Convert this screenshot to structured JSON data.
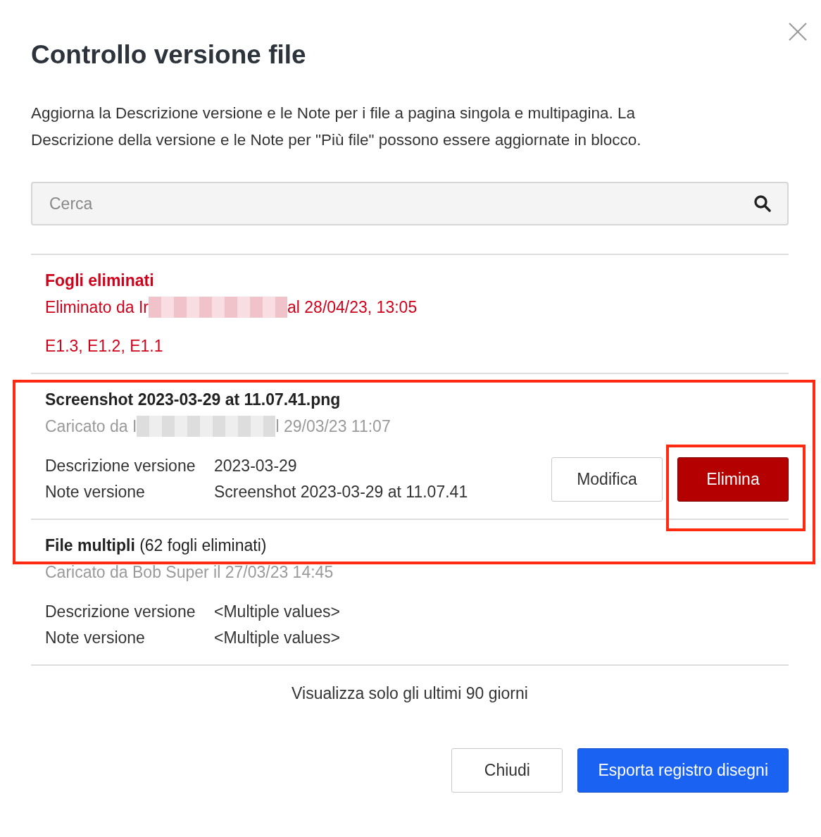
{
  "dialog": {
    "title": "Controllo versione file",
    "description": "Aggiorna la Descrizione versione e le Note per i file a pagina singola e multipagina. La Descrizione della versione e le Note per \"Più file\" possono essere aggiornate in blocco."
  },
  "search": {
    "placeholder": "Cerca"
  },
  "entries": [
    {
      "kind": "deleted",
      "title": "Fogli eliminati",
      "meta": [
        {
          "kind": "text",
          "text": "Eliminato da Ir"
        },
        {
          "kind": "redacted"
        },
        {
          "kind": "text",
          "text": "al 28/04/23, 13:05"
        }
      ],
      "sheets": "E1.3, E1.2, E1.1"
    },
    {
      "kind": "file",
      "title": "Screenshot 2023-03-29 at 11.07.41.png",
      "meta": [
        {
          "kind": "text",
          "text": "Caricato da I"
        },
        {
          "kind": "redacted"
        },
        {
          "kind": "text",
          "text": "l 29/03/23 11:07"
        }
      ],
      "fields": [
        {
          "label": "Descrizione versione",
          "value": "2023-03-29"
        },
        {
          "label": "Note versione",
          "value": "Screenshot 2023-03-29 at 11.07.41"
        }
      ],
      "buttons": [
        {
          "label": "Modifica",
          "kind": "secondary"
        },
        {
          "label": "Elimina",
          "kind": "danger"
        }
      ]
    },
    {
      "kind": "file",
      "title": "File multipli",
      "title_note": "(62 fogli eliminati)",
      "meta": [
        {
          "kind": "text",
          "text": "Caricato da Bob Super il 27/03/23 14:45"
        }
      ],
      "fields": [
        {
          "label": "Descrizione versione",
          "value": "<Multiple values>"
        },
        {
          "label": "Note versione",
          "value": "<Multiple values>"
        }
      ]
    }
  ],
  "footer_note": "Visualizza solo gli ultimi 90 giorni",
  "buttons": [
    {
      "label": "Chiudi",
      "kind": "secondary"
    },
    {
      "label": "Esporta registro disegni",
      "kind": "primary"
    }
  ]
}
